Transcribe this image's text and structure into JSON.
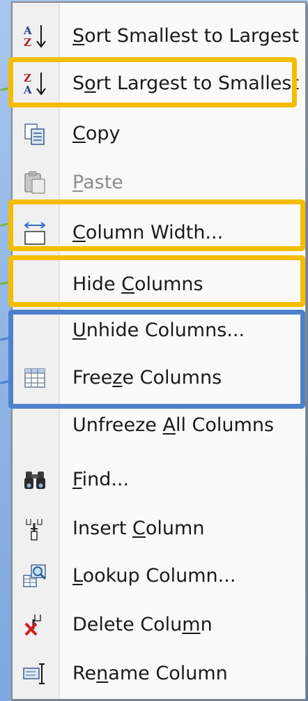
{
  "colors": {
    "highlight_gold": "#f5bd00",
    "highlight_blue": "#4d82cb",
    "connector_green": "#7fb24a"
  },
  "menu": {
    "items": [
      {
        "pre": "",
        "acc": "S",
        "post": "ort Smallest to Largest",
        "icon": "sort-ascending-icon"
      },
      {
        "pre": "S",
        "acc": "o",
        "post": "rt Largest to Smallest",
        "icon": "sort-descending-icon"
      },
      {
        "pre": "",
        "acc": "C",
        "post": "opy",
        "icon": "copy-icon"
      },
      {
        "pre": "",
        "acc": "P",
        "post": "aste",
        "icon": "paste-icon",
        "disabled": true
      },
      {
        "pre": "",
        "acc": "C",
        "post": "olumn Width...",
        "icon": "column-width-icon"
      },
      {
        "pre": "Hide ",
        "acc": "C",
        "post": "olumns",
        "icon": ""
      },
      {
        "pre": "",
        "acc": "U",
        "post": "nhide Columns...",
        "icon": ""
      },
      {
        "pre": "Free",
        "acc": "z",
        "post": "e Columns",
        "icon": "freeze-grid-icon"
      },
      {
        "pre": "Unfreeze ",
        "acc": "A",
        "post": "ll Columns",
        "icon": ""
      },
      {
        "pre": "",
        "acc": "F",
        "post": "ind...",
        "icon": "binoculars-icon"
      },
      {
        "pre": "Insert ",
        "acc": "C",
        "post": "olumn",
        "icon": "insert-column-icon"
      },
      {
        "pre": "",
        "acc": "L",
        "post": "ookup Column...",
        "icon": "lookup-column-icon"
      },
      {
        "pre": "Delete Colu",
        "acc": "m",
        "post": "n",
        "icon": "delete-column-icon"
      },
      {
        "pre": "Re",
        "acc": "n",
        "post": "ame Column",
        "icon": "rename-column-icon"
      }
    ]
  }
}
